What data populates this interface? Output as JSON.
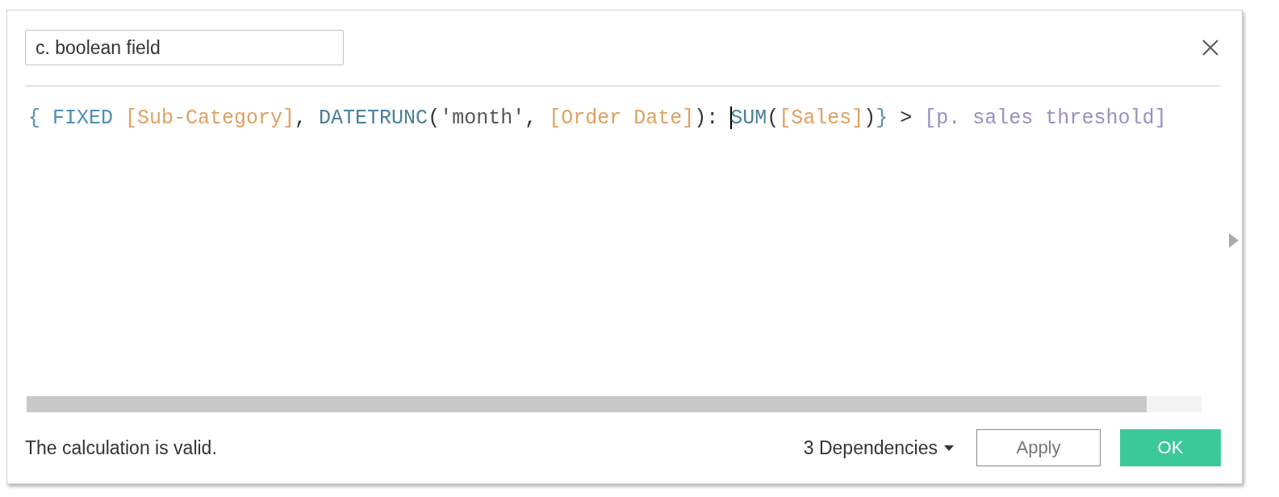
{
  "dialog": {
    "name_field": {
      "value": "c. boolean field"
    },
    "formula": [
      {
        "text": "{ FIXED ",
        "kind": "keyword"
      },
      {
        "text": "[Sub-Category]",
        "kind": "field"
      },
      {
        "text": ", ",
        "kind": "punct"
      },
      {
        "text": "DATETRUNC",
        "kind": "function"
      },
      {
        "text": "(",
        "kind": "punct"
      },
      {
        "text": "'month'",
        "kind": "string"
      },
      {
        "text": ", ",
        "kind": "punct"
      },
      {
        "text": "[Order Date]",
        "kind": "field"
      },
      {
        "text": "): ",
        "kind": "punct"
      },
      {
        "text": "SUM",
        "kind": "function",
        "caret": true
      },
      {
        "text": "(",
        "kind": "punct"
      },
      {
        "text": "[Sales]",
        "kind": "field"
      },
      {
        "text": ")",
        "kind": "punct"
      },
      {
        "text": "}",
        "kind": "keyword"
      },
      {
        "text": " > ",
        "kind": "punct"
      },
      {
        "text": "[p. sales threshold]",
        "kind": "parameter"
      }
    ],
    "status": "The calculation is valid.",
    "dependencies": "3 Dependencies",
    "buttons": [
      {
        "label": "Apply",
        "kind": "secondary"
      },
      {
        "label": "OK",
        "kind": "primary"
      }
    ]
  }
}
